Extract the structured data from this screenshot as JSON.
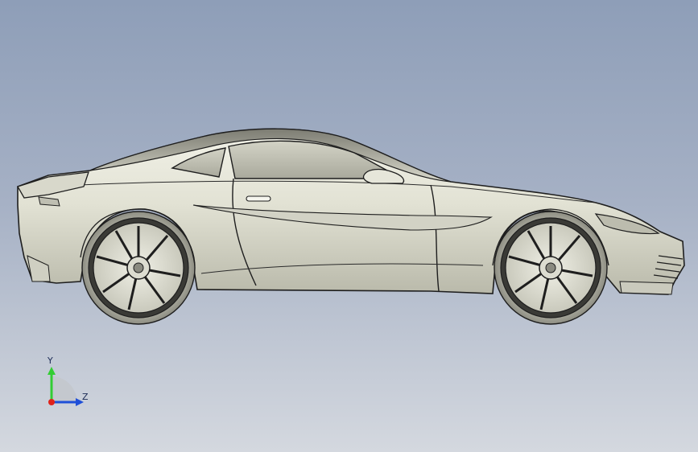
{
  "viewport": {
    "background_top": "#8e9eb8",
    "background_bottom": "#d4d8df",
    "model_body_color": "#e4e4d7",
    "edge_color": "#1e1e1e"
  },
  "model": {
    "name": "car-side-view",
    "view": "right side"
  },
  "triad": {
    "y_label": "Y",
    "z_label": "Z",
    "y_color": "#32cd32",
    "z_color": "#1f4fd8",
    "x_color": "#e0221a"
  }
}
